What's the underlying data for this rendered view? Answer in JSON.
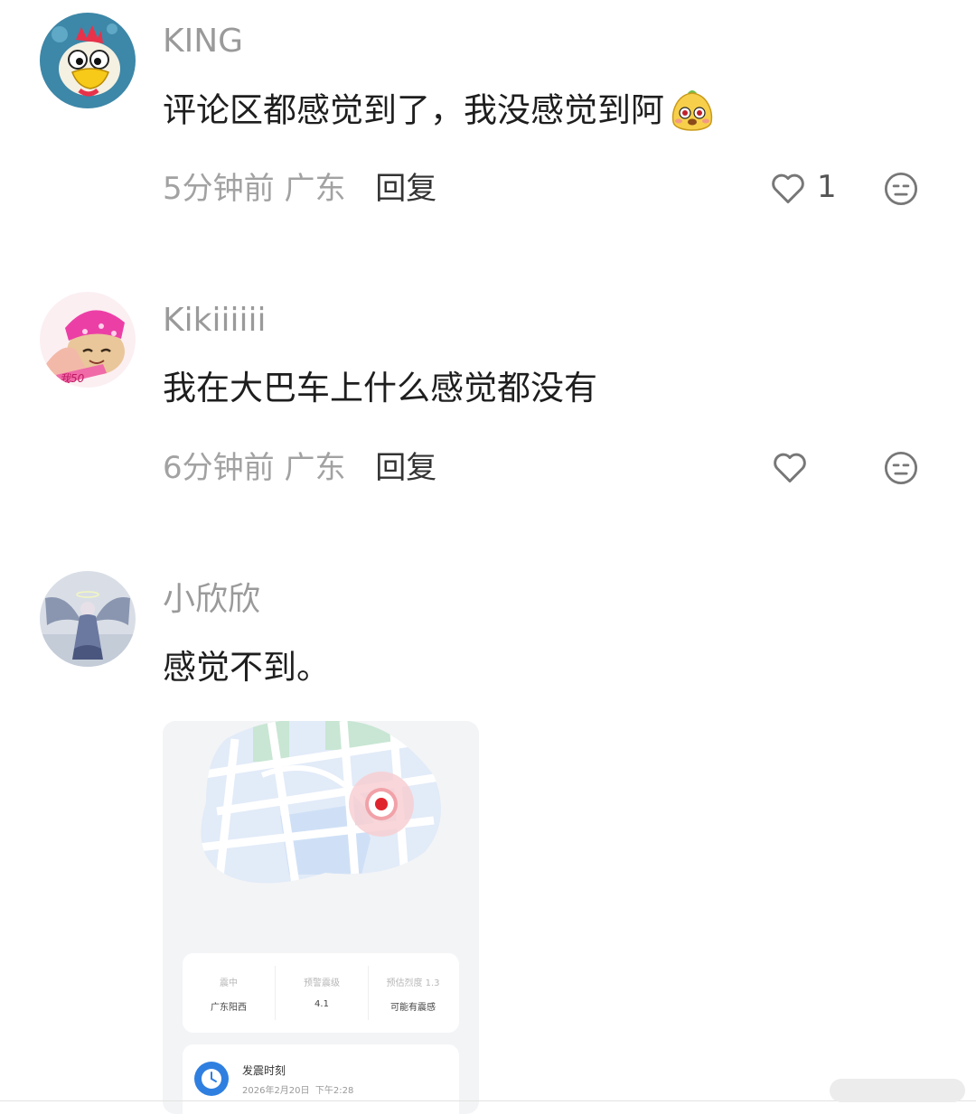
{
  "comments": [
    {
      "username": "KING",
      "text": "评论区都感觉到了，我没感觉到阿",
      "time": "5分钟前",
      "location": "广东",
      "reply_label": "回复",
      "likes": "1",
      "emoji": "fruit-emoji"
    },
    {
      "username": "Kikiiiiii",
      "text": "我在大巴车上什么感觉都没有",
      "time": "6分钟前",
      "location": "广东",
      "reply_label": "回复",
      "likes": ""
    },
    {
      "username": "小欣欣",
      "text": "感觉不到。"
    }
  ],
  "attachment": {
    "info": [
      {
        "label": "震中",
        "value": "广东阳西"
      },
      {
        "label": "预警震级",
        "value": "4.1"
      },
      {
        "label": "预估烈度 1.3",
        "value": "可能有震感"
      }
    ],
    "time_title": "发震时刻",
    "time_value": "2026年2月20日  下午2:28"
  },
  "colors": {
    "username": "#9a9a9a",
    "meta": "#a2a2a2",
    "epicenter": "#e0242e",
    "clock": "#2f7fe0"
  },
  "icons": {
    "like": "heart-outline-icon",
    "dislike": "meh-face-icon",
    "home_indicator": "home-indicator"
  }
}
